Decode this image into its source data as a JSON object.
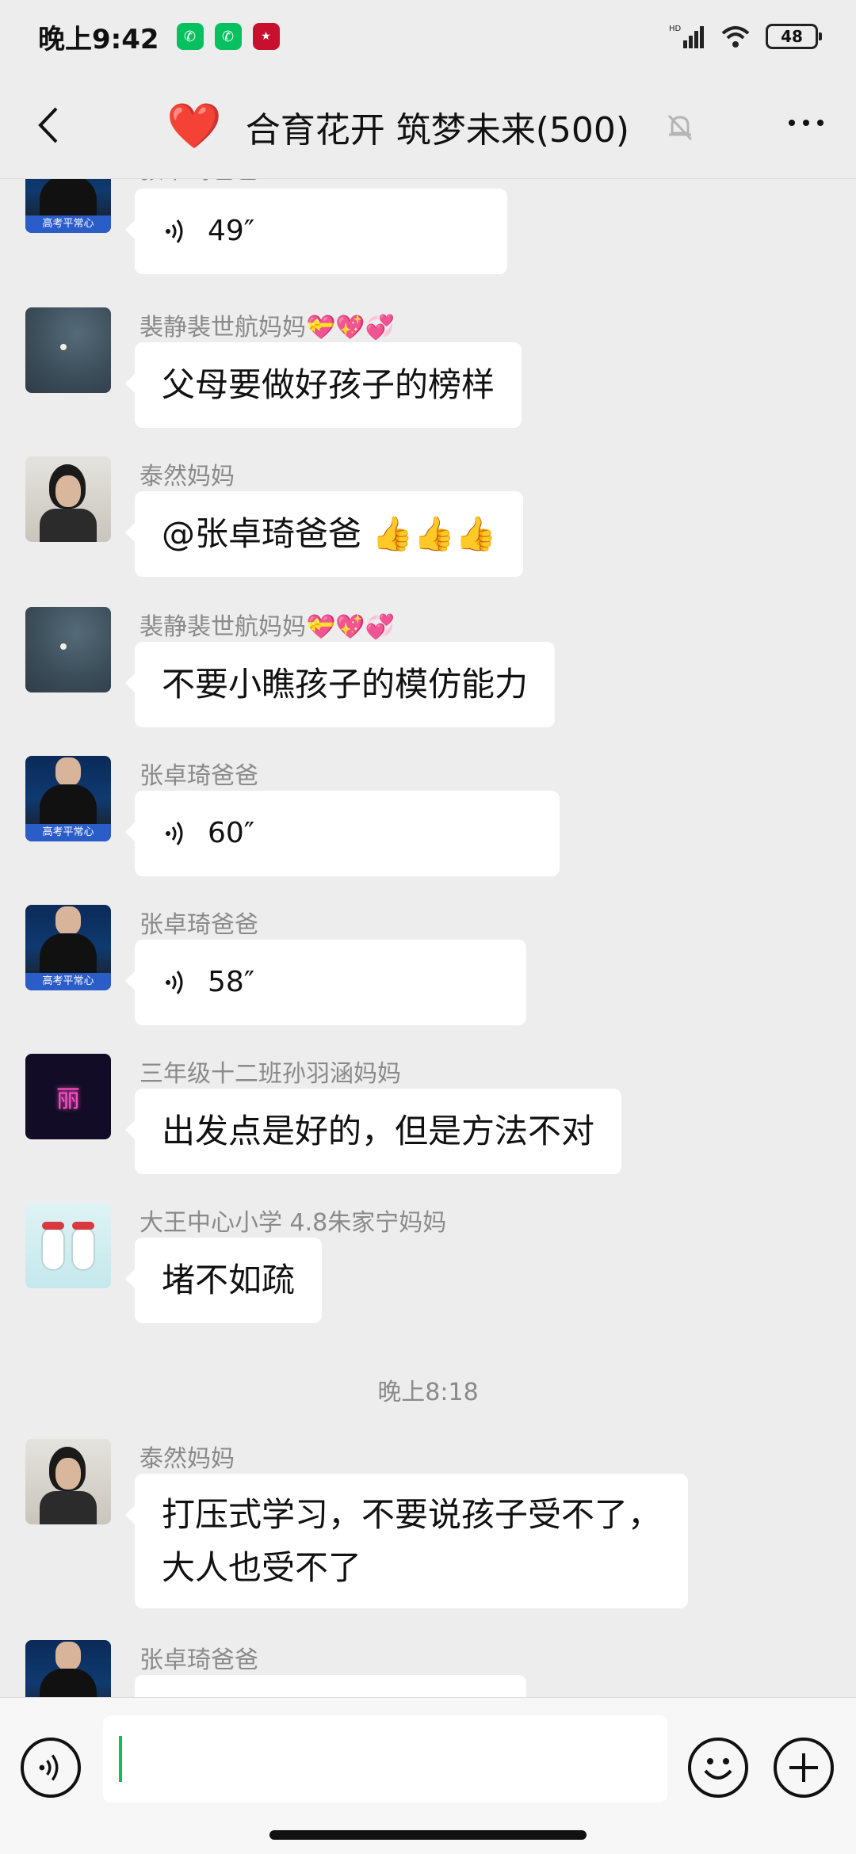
{
  "status_bar": {
    "time": "晚上9:42",
    "battery": "48",
    "network_label": "HD"
  },
  "header": {
    "title": "合育花开 筑梦未来(500)",
    "title_emoji": "❤️"
  },
  "messages": [
    {
      "sender": "张卓琦爸爸",
      "type": "voice",
      "duration": "49″",
      "avatar": "man-in-suit"
    },
    {
      "sender": "裴静裴世航妈妈💝💖💞",
      "type": "text",
      "text": "父母要做好孩子的榜样",
      "avatar": "night-sky"
    },
    {
      "sender": "泰然妈妈",
      "type": "text",
      "text": "@张卓琦爸爸 👍👍👍",
      "avatar": "woman-portrait"
    },
    {
      "sender": "裴静裴世航妈妈💝💖💞",
      "type": "text",
      "text": "不要小瞧孩子的模仿能力",
      "avatar": "night-sky"
    },
    {
      "sender": "张卓琦爸爸",
      "type": "voice",
      "duration": "60″",
      "avatar": "man-in-suit"
    },
    {
      "sender": "张卓琦爸爸",
      "type": "voice",
      "duration": "58″",
      "avatar": "man-in-suit"
    },
    {
      "sender": "三年级十二班孙羽涵妈妈",
      "type": "text",
      "text": "出发点是好的，但是方法不对",
      "avatar": "neon-sign"
    },
    {
      "sender": "大王中心小学 4.8朱家宁妈妈",
      "type": "text",
      "text": "堵不如疏",
      "avatar": "snowmen"
    },
    {
      "time_separator": "晚上8:18"
    },
    {
      "sender": "泰然妈妈",
      "type": "text",
      "text_lines": [
        "打压式学习，不要说孩子受不了，",
        "大人也受不了"
      ],
      "avatar": "woman-portrait"
    },
    {
      "sender": "张卓琦爸爸",
      "type": "voice",
      "duration": "",
      "avatar": "man-in-suit"
    }
  ],
  "avatar_texts": {
    "man_tag": "高考平常心",
    "neon_text": "丽"
  },
  "colors": {
    "accent_green": "#07c160",
    "background": "#ededed",
    "bubble": "#ffffff",
    "sender_name": "#8a8a8a"
  },
  "icons": {
    "back": "chevron-left-icon",
    "mute": "bell-off-icon",
    "more": "more-dots-icon",
    "voice": "voice-wave-icon",
    "emoji": "smile-icon",
    "plus": "plus-circle-icon"
  }
}
